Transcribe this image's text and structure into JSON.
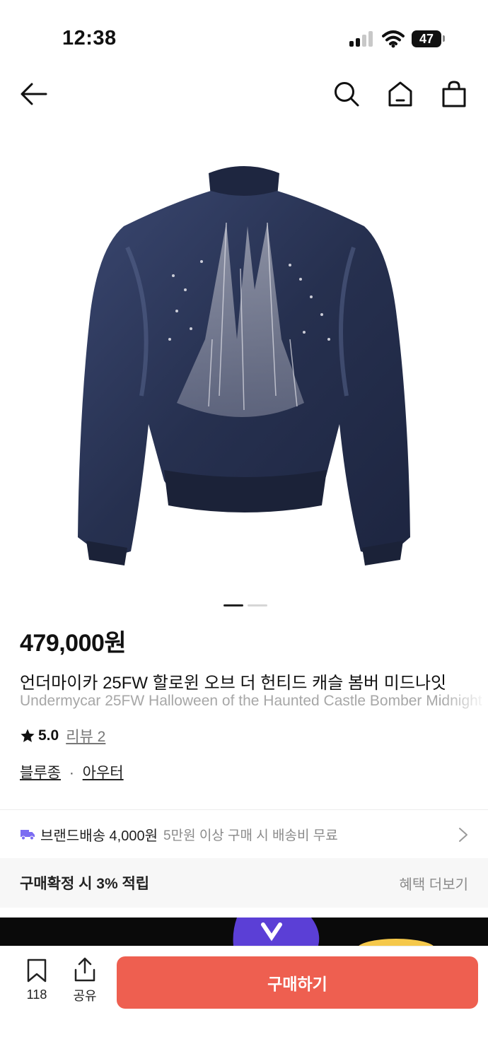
{
  "status_bar": {
    "time": "12:38",
    "battery": "47"
  },
  "nav": {
    "back_icon": "arrow-left-icon",
    "search_icon": "search-icon",
    "home_icon": "home-icon",
    "cart_icon": "shopping-bag-icon"
  },
  "product": {
    "image_alt": "bomber-jacket-image",
    "carousel": {
      "current": 1,
      "total": 2
    },
    "price": "479,000원",
    "title_ko": "언더마이카 25FW 할로윈 오브 더 헌티드 캐슬 봄버 미드나잇",
    "title_en": "Undermycar 25FW Halloween of the Haunted Castle Bomber Midnight",
    "rating": "5.0",
    "review_label": "리뷰 2",
    "category_1": "블루종",
    "separator": "·",
    "category_2": "아우터"
  },
  "shipping": {
    "label": "브랜드배송 4,000원",
    "note": "5만원 이상 구매 시 배송비 무료"
  },
  "benefit": {
    "label": "구매확정 시 3% 적립",
    "more": "혜택 더보기"
  },
  "bottom_bar": {
    "bookmark_count": "118",
    "share_label": "공유",
    "buy_label": "구매하기"
  },
  "colors": {
    "accent": "#ee5f50",
    "truck": "#7b6cf2",
    "jacket": "#2a3556"
  }
}
